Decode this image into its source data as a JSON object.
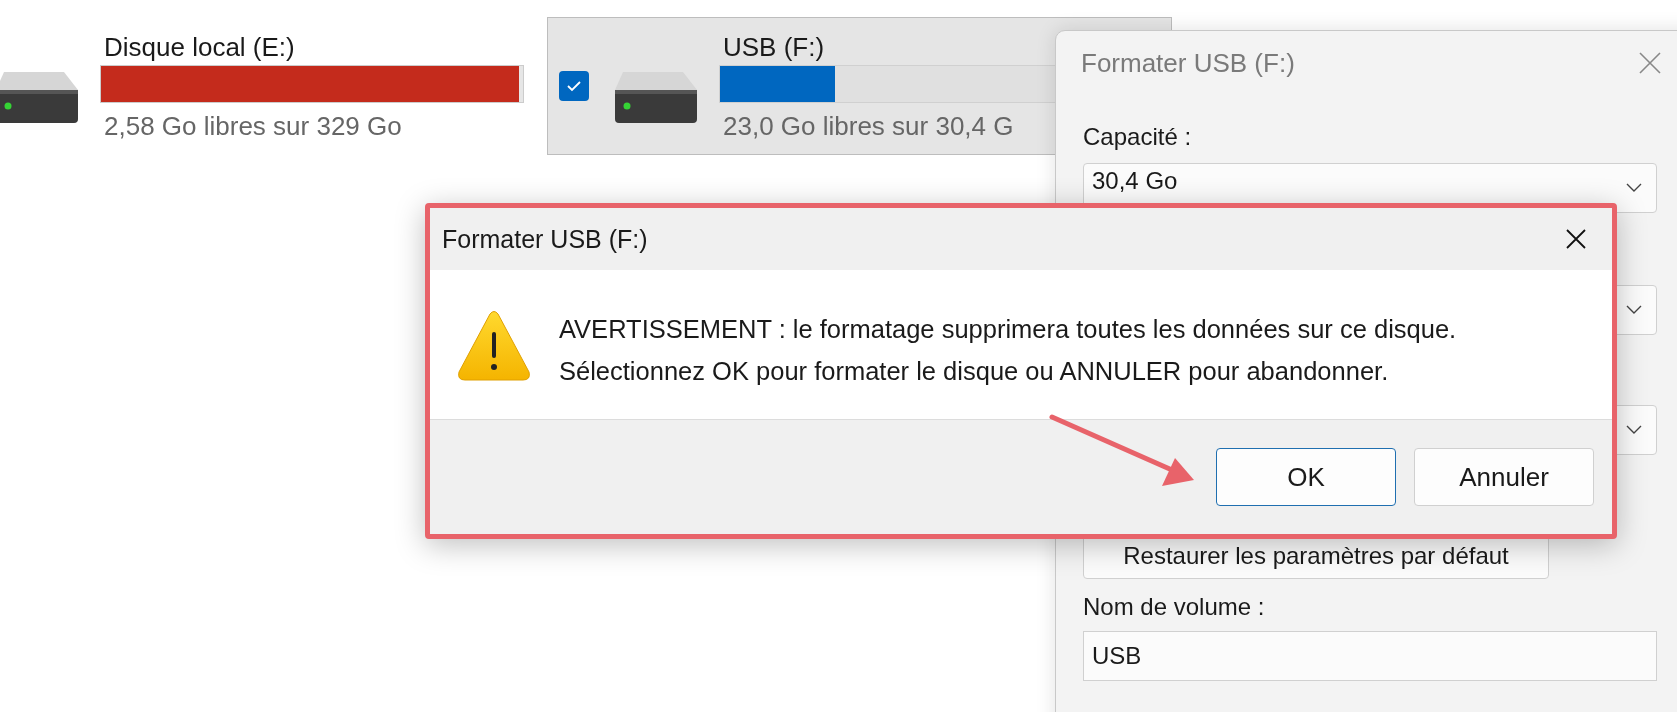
{
  "drives": [
    {
      "name": "Disque local (E:)",
      "free": "2,58 Go libres sur 329 Go",
      "level": 0.99,
      "color": "#c42b1c",
      "selected": false
    },
    {
      "name": "USB (F:)",
      "free": "23,0 Go libres sur 30,4 G",
      "level": 0.29,
      "color": "#0067c0",
      "selected": true
    }
  ],
  "format_dialog": {
    "title": "Formater USB (F:)",
    "capacity_label": "Capacité :",
    "capacity_value": "30,4 Go",
    "restore_button": "Restaurer les paramètres par défaut",
    "volume_label": "Nom de volume :",
    "volume_value": "USB"
  },
  "confirm_dialog": {
    "title": "Formater USB (F:)",
    "message": [
      "AVERTISSEMENT : le formatage supprimera toutes les données sur ce disque.",
      "Sélectionnez OK pour formater le disque ou ANNULER pour abandonner."
    ],
    "buttons": [
      {
        "label": "OK",
        "default": true
      },
      {
        "label": "Annuler",
        "default": false
      }
    ]
  }
}
